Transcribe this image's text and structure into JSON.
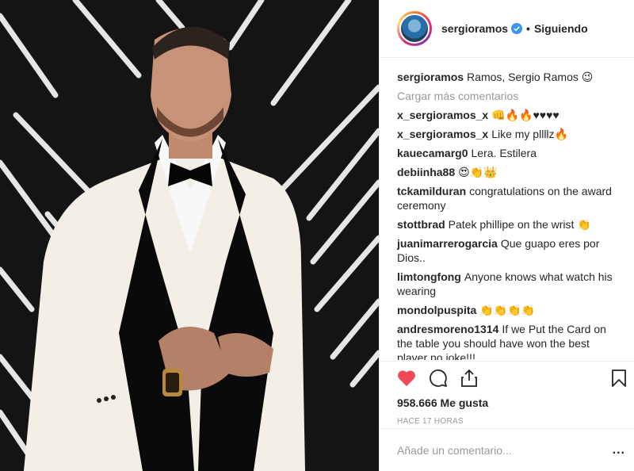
{
  "header": {
    "username": "sergioramos",
    "separator": "•",
    "follow_status": "Siguiendo"
  },
  "caption": {
    "username": "sergioramos",
    "text": "Ramos, Sergio Ramos 😉"
  },
  "load_more": "Cargar más comentarios",
  "comments": [
    {
      "user": "x_sergioramos_x",
      "text": "👊🔥🔥♥♥♥♥"
    },
    {
      "user": "x_sergioramos_x",
      "text": "Like my pllllz🔥"
    },
    {
      "user": "kauecamarg0",
      "text": "Lera. Estilera"
    },
    {
      "user": "debiinha88",
      "text": "😍👏👑"
    },
    {
      "user": "tckamilduran",
      "text": "congratulations on the award ceremony"
    },
    {
      "user": "stottbrad",
      "text": "Patek phillipe on the wrist 👏"
    },
    {
      "user": "juanimarrerogarcia",
      "text": "Que guapo eres por Dios.."
    },
    {
      "user": "limtongfong",
      "text": "Anyone knows what watch his wearing"
    },
    {
      "user": "mondolpuspita",
      "text": "👏👏👏👏"
    },
    {
      "user": "andresmoreno1314",
      "text": "If we Put the Card on the table you should have won the best player no joke!!!"
    }
  ],
  "likes": "958.666 Me gusta",
  "timestamp": "HACE 17 HORAS",
  "add_comment_placeholder": "Añade un comentario...",
  "more_options": "...",
  "colors": {
    "heart": "#ed4956",
    "verified": "#3897f0",
    "muted": "#999999"
  },
  "icons": [
    "heart-icon",
    "comment-icon",
    "share-icon",
    "bookmark-icon",
    "verified-icon"
  ]
}
